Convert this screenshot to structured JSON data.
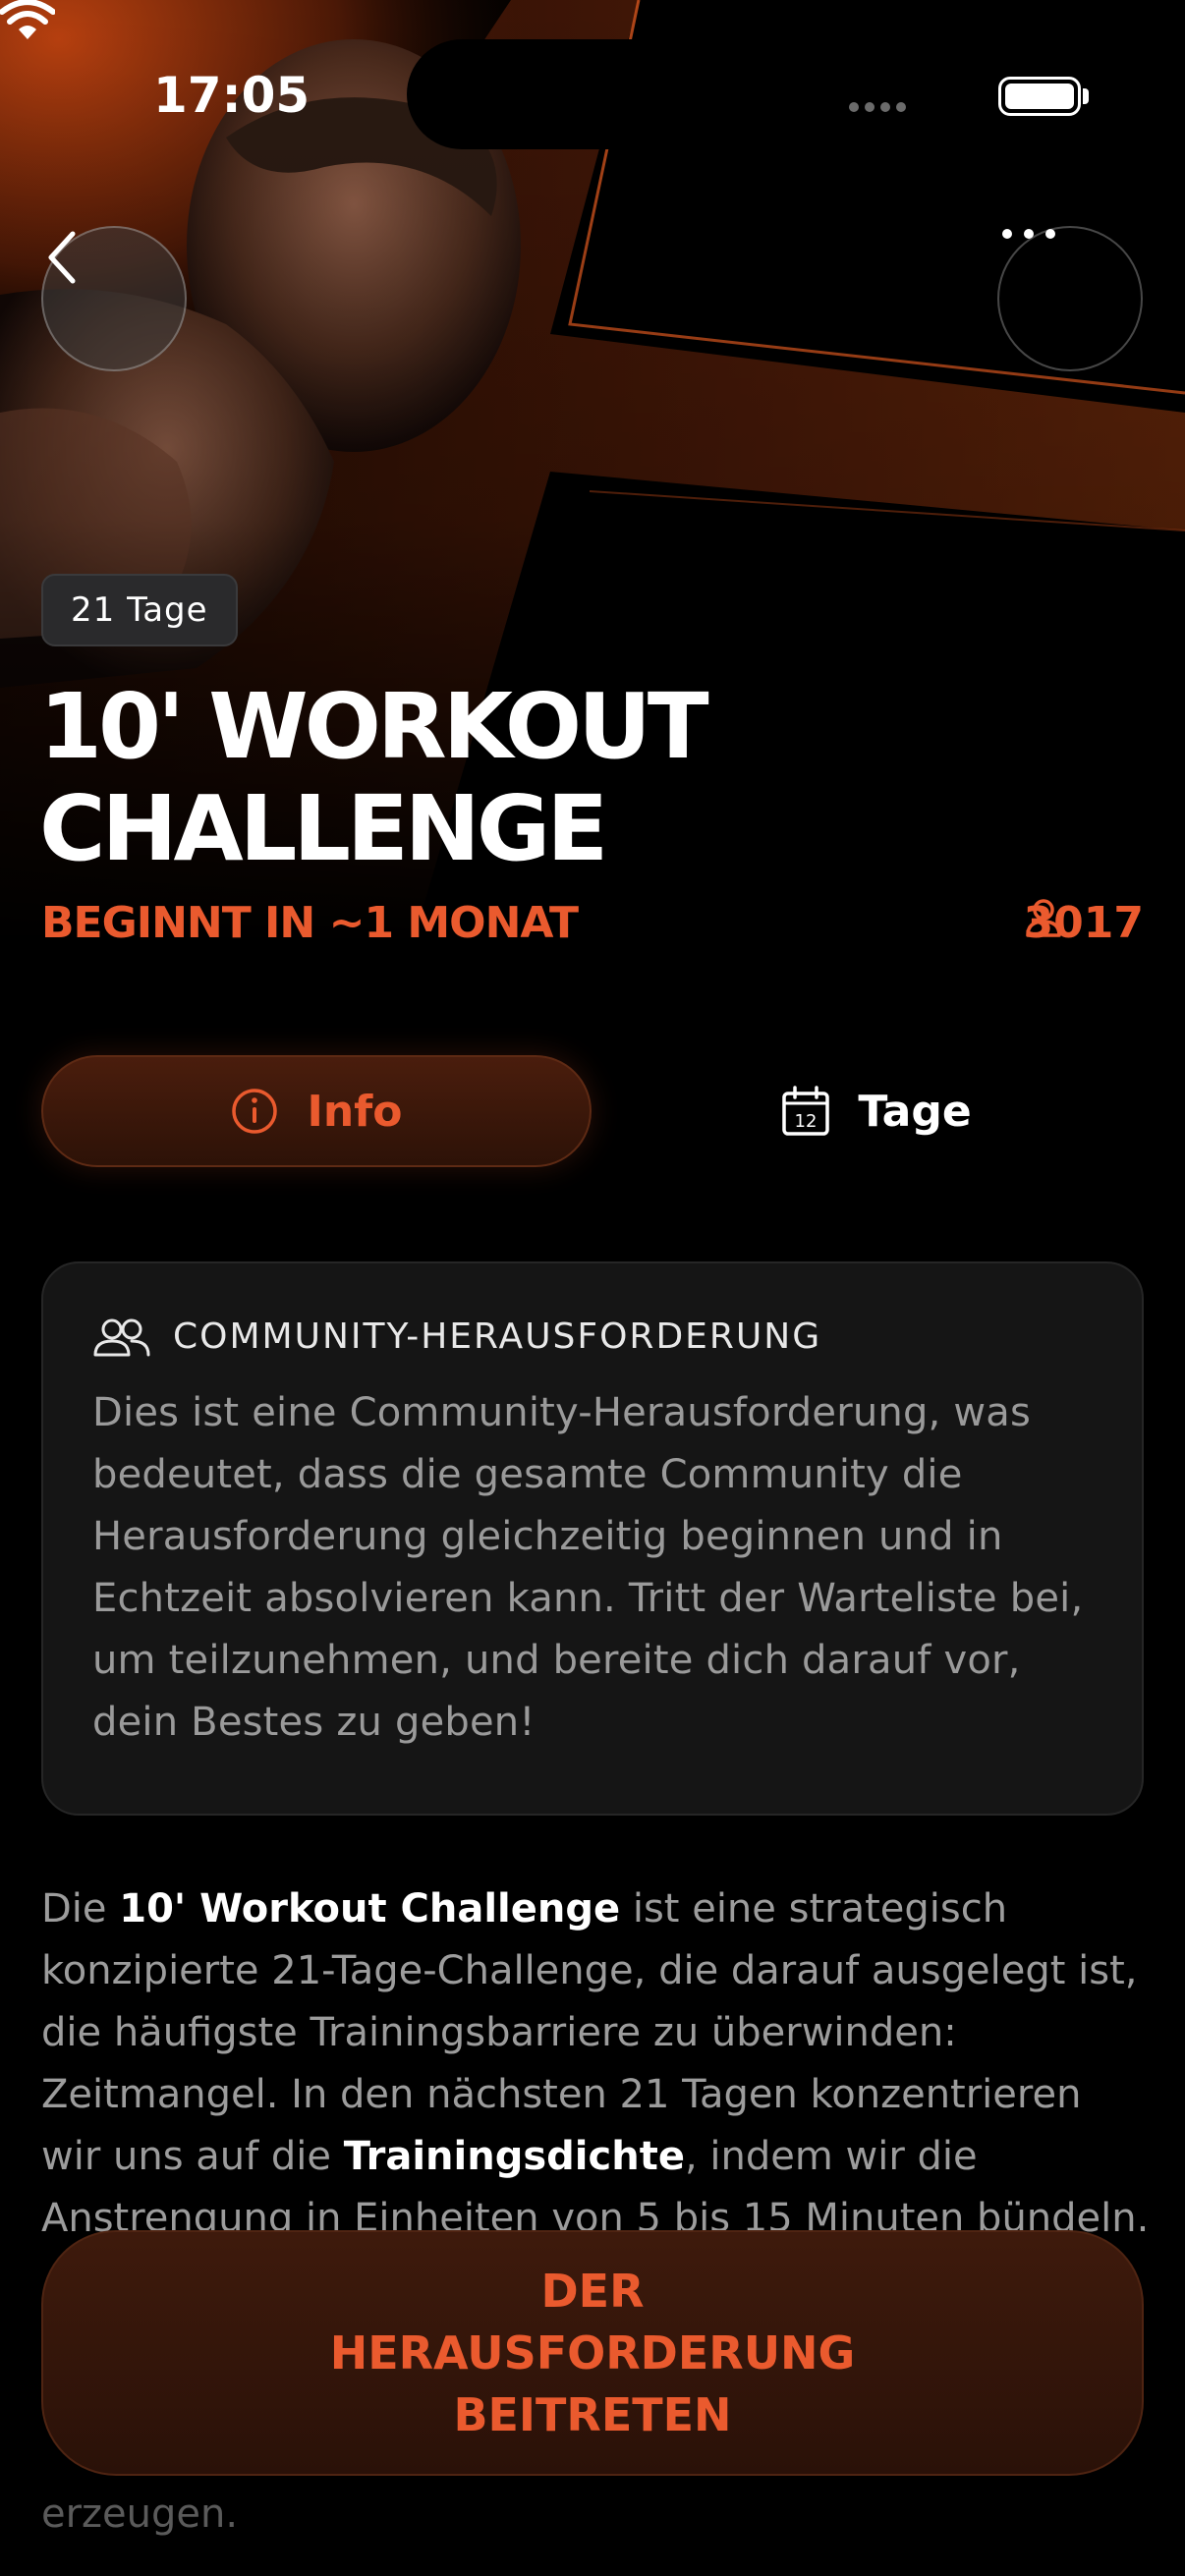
{
  "status_bar": {
    "time": "17:05"
  },
  "hero": {
    "badge": "21 Tage",
    "title": "10' WORKOUT CHALLENGE",
    "start_text": "BEGINNT IN ~1 MONAT",
    "participants": "3017"
  },
  "tabs": [
    {
      "label": "Info",
      "icon": "info-icon",
      "active": true
    },
    {
      "label": "Tage",
      "icon": "calendar-icon",
      "calendar_day": "12",
      "active": false
    }
  ],
  "community_card": {
    "title": "COMMUNITY-HERAUSFORDERUNG",
    "icon": "users-icon",
    "body": "Dies ist eine Community-Herausforderung, was bedeutet, dass die gesamte Community die Herausforderung gleichzeitig beginnen und in Echtzeit absolvieren kann. Tritt der Warteliste bei, um teilzunehmen, und bereite dich darauf vor, dein Bestes zu geben!"
  },
  "description": {
    "p1": "Die ",
    "b1": "10' Workout Challenge",
    "p2": " ist eine strategisch konzipierte 21-Tage-Challenge, die darauf ausgelegt ist, die häufigste Trainingsbarriere zu überwinden: Zeitmangel. In den nächsten 21 Tagen konzentrieren wir uns auf die ",
    "b2": "Trainingsdichte",
    "p3": ", indem wir die Anstrengung in Einheiten von 5 bis 15 Minuten bündeln.",
    "tail": "erzeugen."
  },
  "cta": {
    "label": "DER HERAUSFORDERUNG BEITRETEN"
  },
  "colors": {
    "accent": "#ea5a2e",
    "background": "#000000",
    "card": "#151515"
  }
}
